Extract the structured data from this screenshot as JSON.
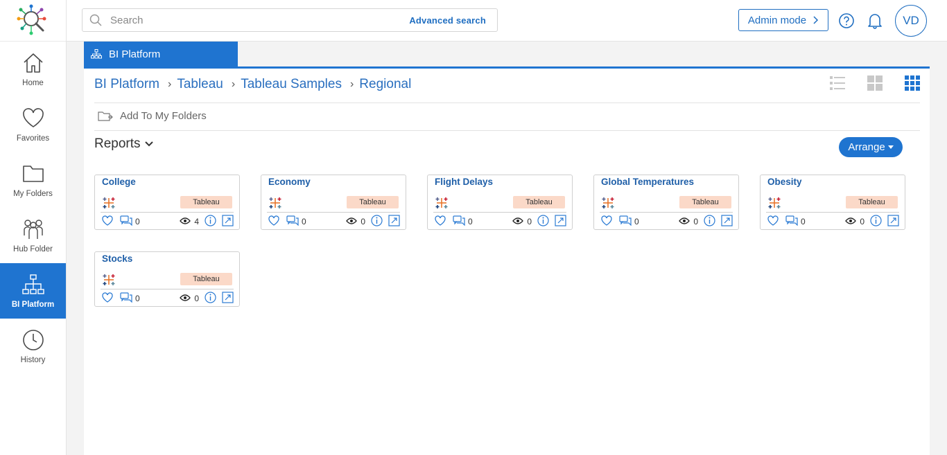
{
  "sidebar": {
    "items": [
      {
        "label": "Home",
        "icon": "home-icon"
      },
      {
        "label": "Favorites",
        "icon": "heart-icon"
      },
      {
        "label": "My Folders",
        "icon": "folder-icon"
      },
      {
        "label": "Hub Folder",
        "icon": "people-icon"
      },
      {
        "label": "BI Platform",
        "icon": "hierarchy-icon",
        "active": true
      },
      {
        "label": "History",
        "icon": "clock-icon"
      }
    ]
  },
  "header": {
    "search_placeholder": "Search",
    "advanced_search": "Advanced search",
    "admin_mode": "Admin mode",
    "avatar": "VD"
  },
  "tab": {
    "label": "BI Platform"
  },
  "breadcrumb": [
    "BI Platform",
    "Tableau",
    "Tableau Samples",
    "Regional"
  ],
  "toolbar": {
    "add_to_folders": "Add To My Folders"
  },
  "section": {
    "title": "Reports",
    "arrange": "Arrange"
  },
  "colors": {
    "accent": "#1f74d0",
    "badge_bg": "#fbd9c8"
  },
  "reports": [
    {
      "title": "College",
      "type": "Tableau",
      "comments": "0",
      "views": "4"
    },
    {
      "title": "Economy",
      "type": "Tableau",
      "comments": "0",
      "views": "0"
    },
    {
      "title": "Flight Delays",
      "type": "Tableau",
      "comments": "0",
      "views": "0"
    },
    {
      "title": "Global Temperatures",
      "type": "Tableau",
      "comments": "0",
      "views": "0"
    },
    {
      "title": "Obesity",
      "type": "Tableau",
      "comments": "0",
      "views": "0"
    },
    {
      "title": "Stocks",
      "type": "Tableau",
      "comments": "0",
      "views": "0"
    }
  ]
}
